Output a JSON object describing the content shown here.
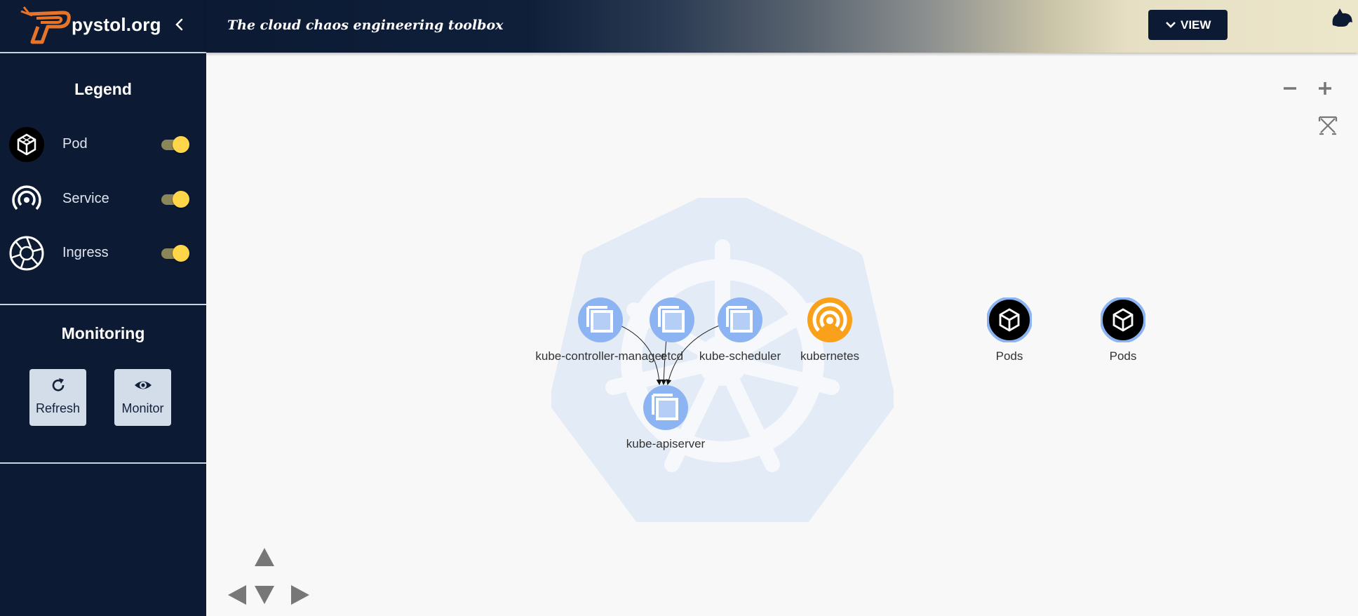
{
  "brand": {
    "name": "pystol.org"
  },
  "header": {
    "tagline": "The cloud chaos engineering toolbox",
    "view_button": "VIEW"
  },
  "legend": {
    "title": "Legend",
    "items": [
      {
        "label": "Pod",
        "icon": "pod-icon",
        "enabled": true
      },
      {
        "label": "Service",
        "icon": "service-icon",
        "enabled": true
      },
      {
        "label": "Ingress",
        "icon": "ingress-icon",
        "enabled": true
      }
    ]
  },
  "monitoring": {
    "title": "Monitoring",
    "buttons": [
      {
        "label": "Refresh",
        "icon": "refresh-icon"
      },
      {
        "label": "Monitor",
        "icon": "eye-icon"
      }
    ]
  },
  "graph": {
    "nodes": [
      {
        "label": "kube-controller-manager",
        "type": "component"
      },
      {
        "label": "etcd",
        "type": "component"
      },
      {
        "label": "kube-scheduler",
        "type": "component"
      },
      {
        "label": "kubernetes",
        "type": "service"
      },
      {
        "label": "kube-apiserver",
        "type": "component"
      },
      {
        "label": "Pods",
        "type": "pod"
      },
      {
        "label": "Pods",
        "type": "pod"
      }
    ],
    "edges": [
      {
        "from": "kube-controller-manager",
        "to": "kube-apiserver"
      },
      {
        "from": "etcd",
        "to": "kube-apiserver"
      },
      {
        "from": "kube-scheduler",
        "to": "kube-apiserver"
      }
    ]
  },
  "colors": {
    "sidebar_bg": "#0c1a33",
    "toggle_on": "#ffd54a",
    "component_node": "#8cb4f2",
    "service_node": "#f9a11b",
    "pod_node": "#000000",
    "brand_accent": "#e8742a"
  }
}
